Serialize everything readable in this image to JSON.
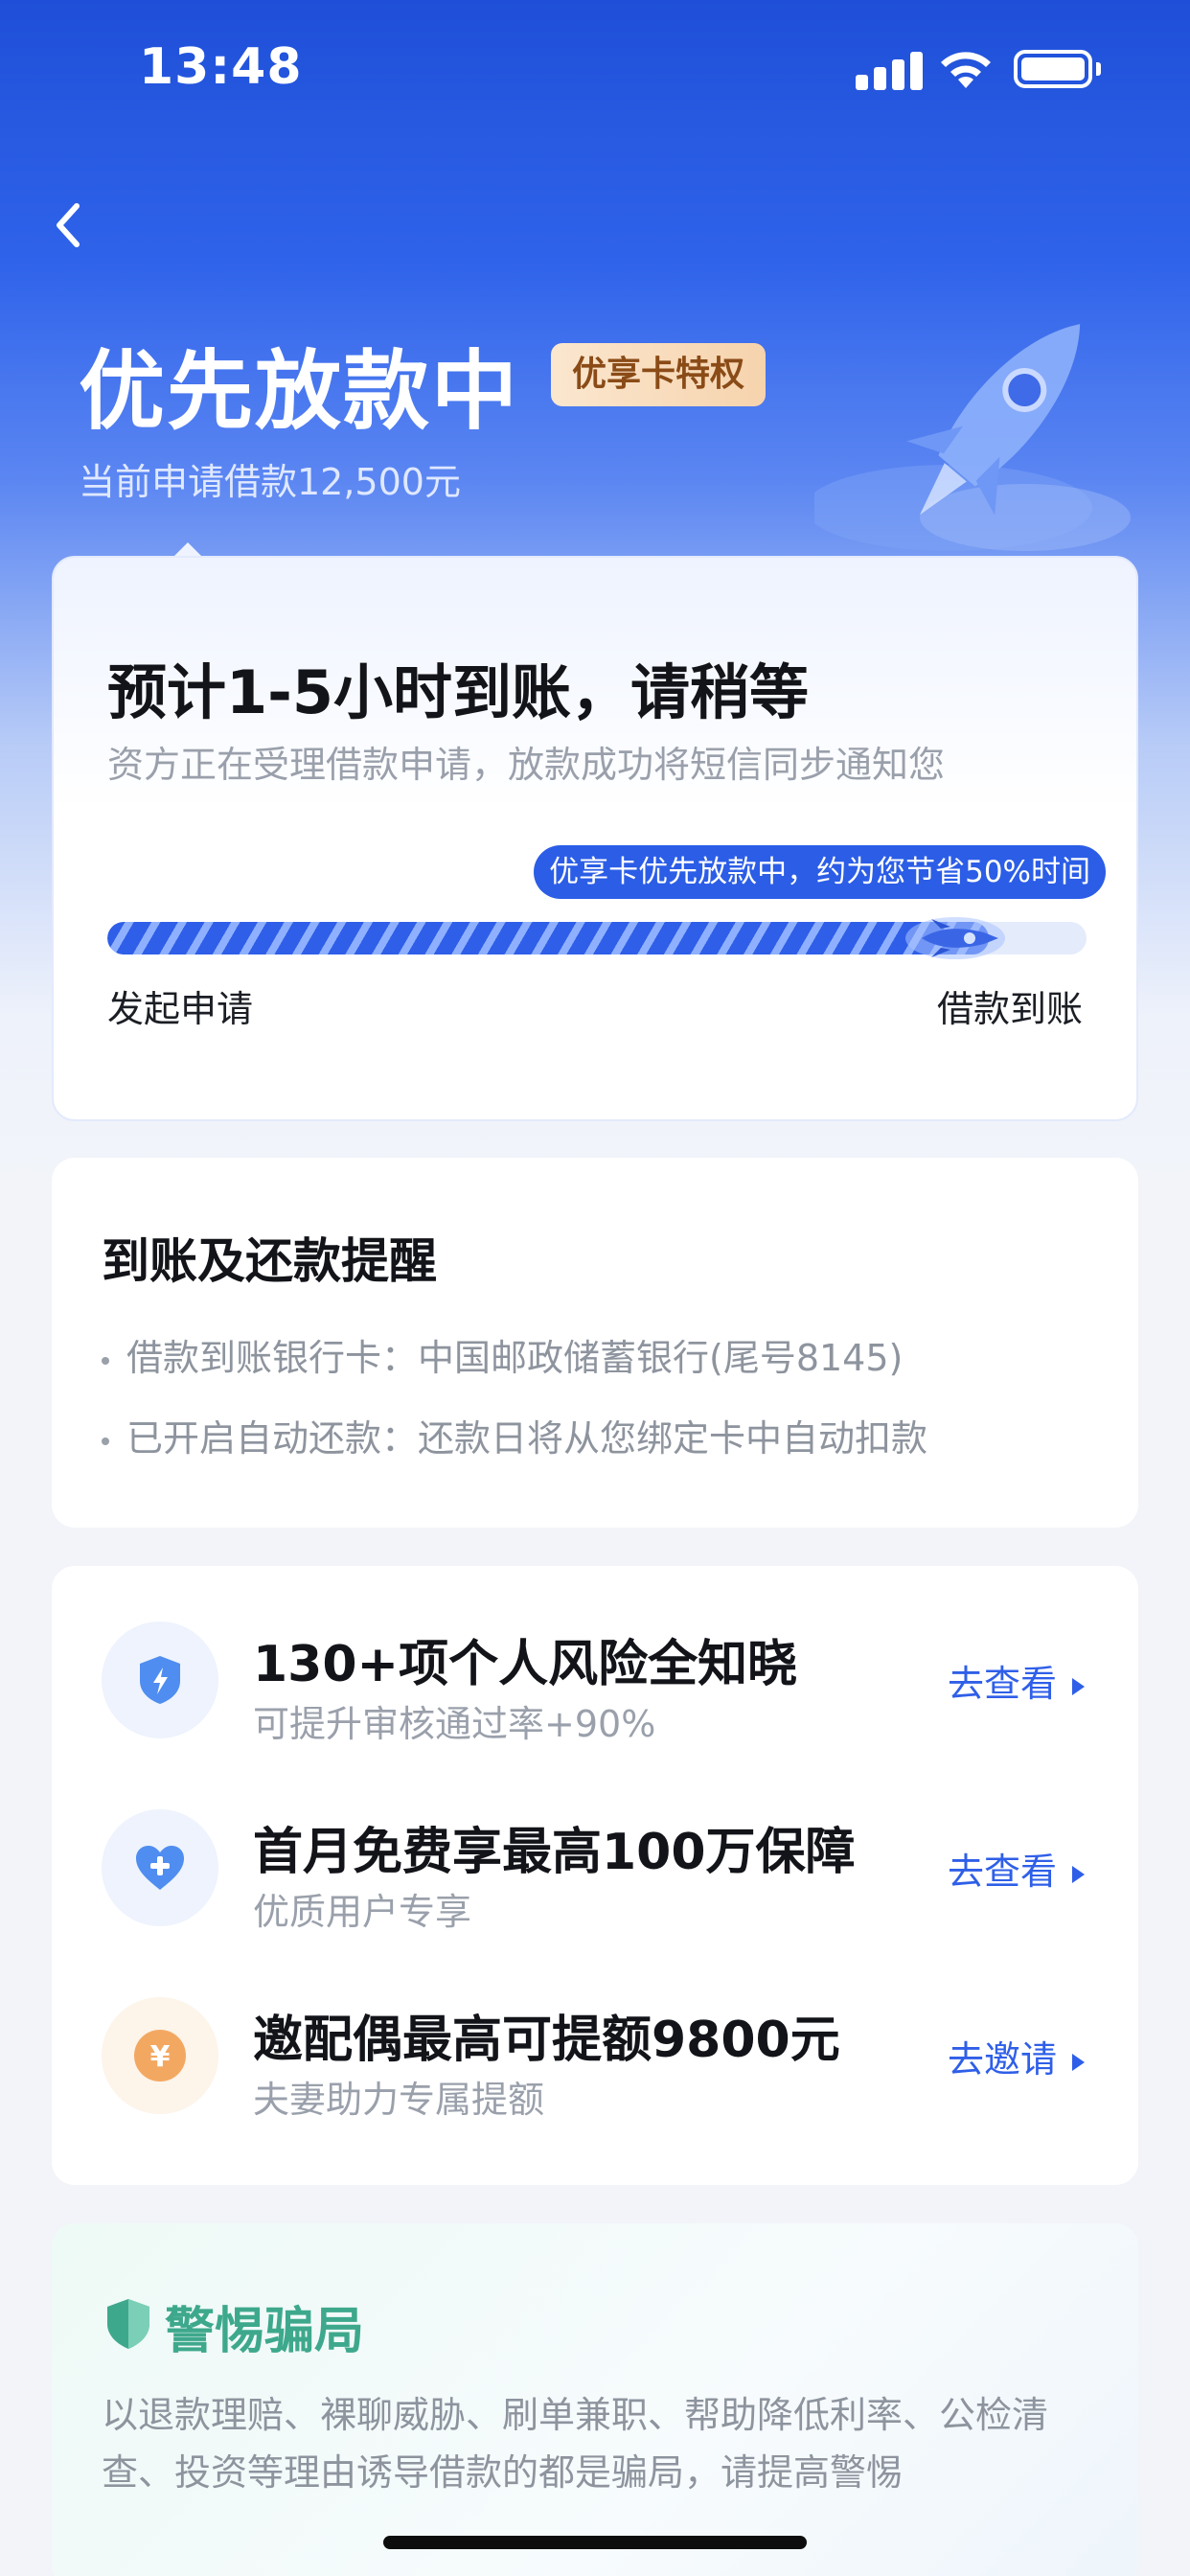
{
  "status_bar": {
    "time": "13:48"
  },
  "header": {
    "title": "优先放款中",
    "tag": "优享卡特权",
    "subtitle": "当前申请借款12,500元"
  },
  "progress_card": {
    "eta": "预计1-5小时到账，请稍等",
    "description": "资方正在受理借款申请，放款成功将短信同步通知您",
    "bubble": "优享卡优先放款中，约为您节省50%时间",
    "progress": 0.9,
    "start_label": "发起申请",
    "end_label": "借款到账"
  },
  "reminder_card": {
    "title": "到账及还款提醒",
    "lines": [
      "借款到账银行卡：中国邮政储蓄银行(尾号8145)",
      "已开启自动还款：还款日将从您绑定卡中自动扣款"
    ]
  },
  "services": [
    {
      "title": "130+项个人风险全知晓",
      "desc": "可提升审核通过率+90%",
      "action": "去查看",
      "icon": "shield-lightning-icon",
      "color": "#4f8df0"
    },
    {
      "title": "首月免费享最高100万保障",
      "desc": "优质用户专享",
      "action": "去查看",
      "icon": "heart-plus-icon",
      "color": "#4f8df0"
    },
    {
      "title": "邀配偶最高可提额9800元",
      "desc": "夫妻助力专属提额",
      "action": "去邀请",
      "icon": "yuan-coin-icon",
      "color": "#f3a862"
    }
  ],
  "warning": {
    "title": "警惕骗局",
    "text": "以退款理赔、裸聊威胁、刷单兼职、帮助降低利率、公检清查、投资等理由诱导借款的都是骗局，请提高警惕"
  },
  "colors": {
    "primary": "#2f5fe8",
    "warning_green": "#3ea88c",
    "tag_brown": "#8a4b17"
  }
}
